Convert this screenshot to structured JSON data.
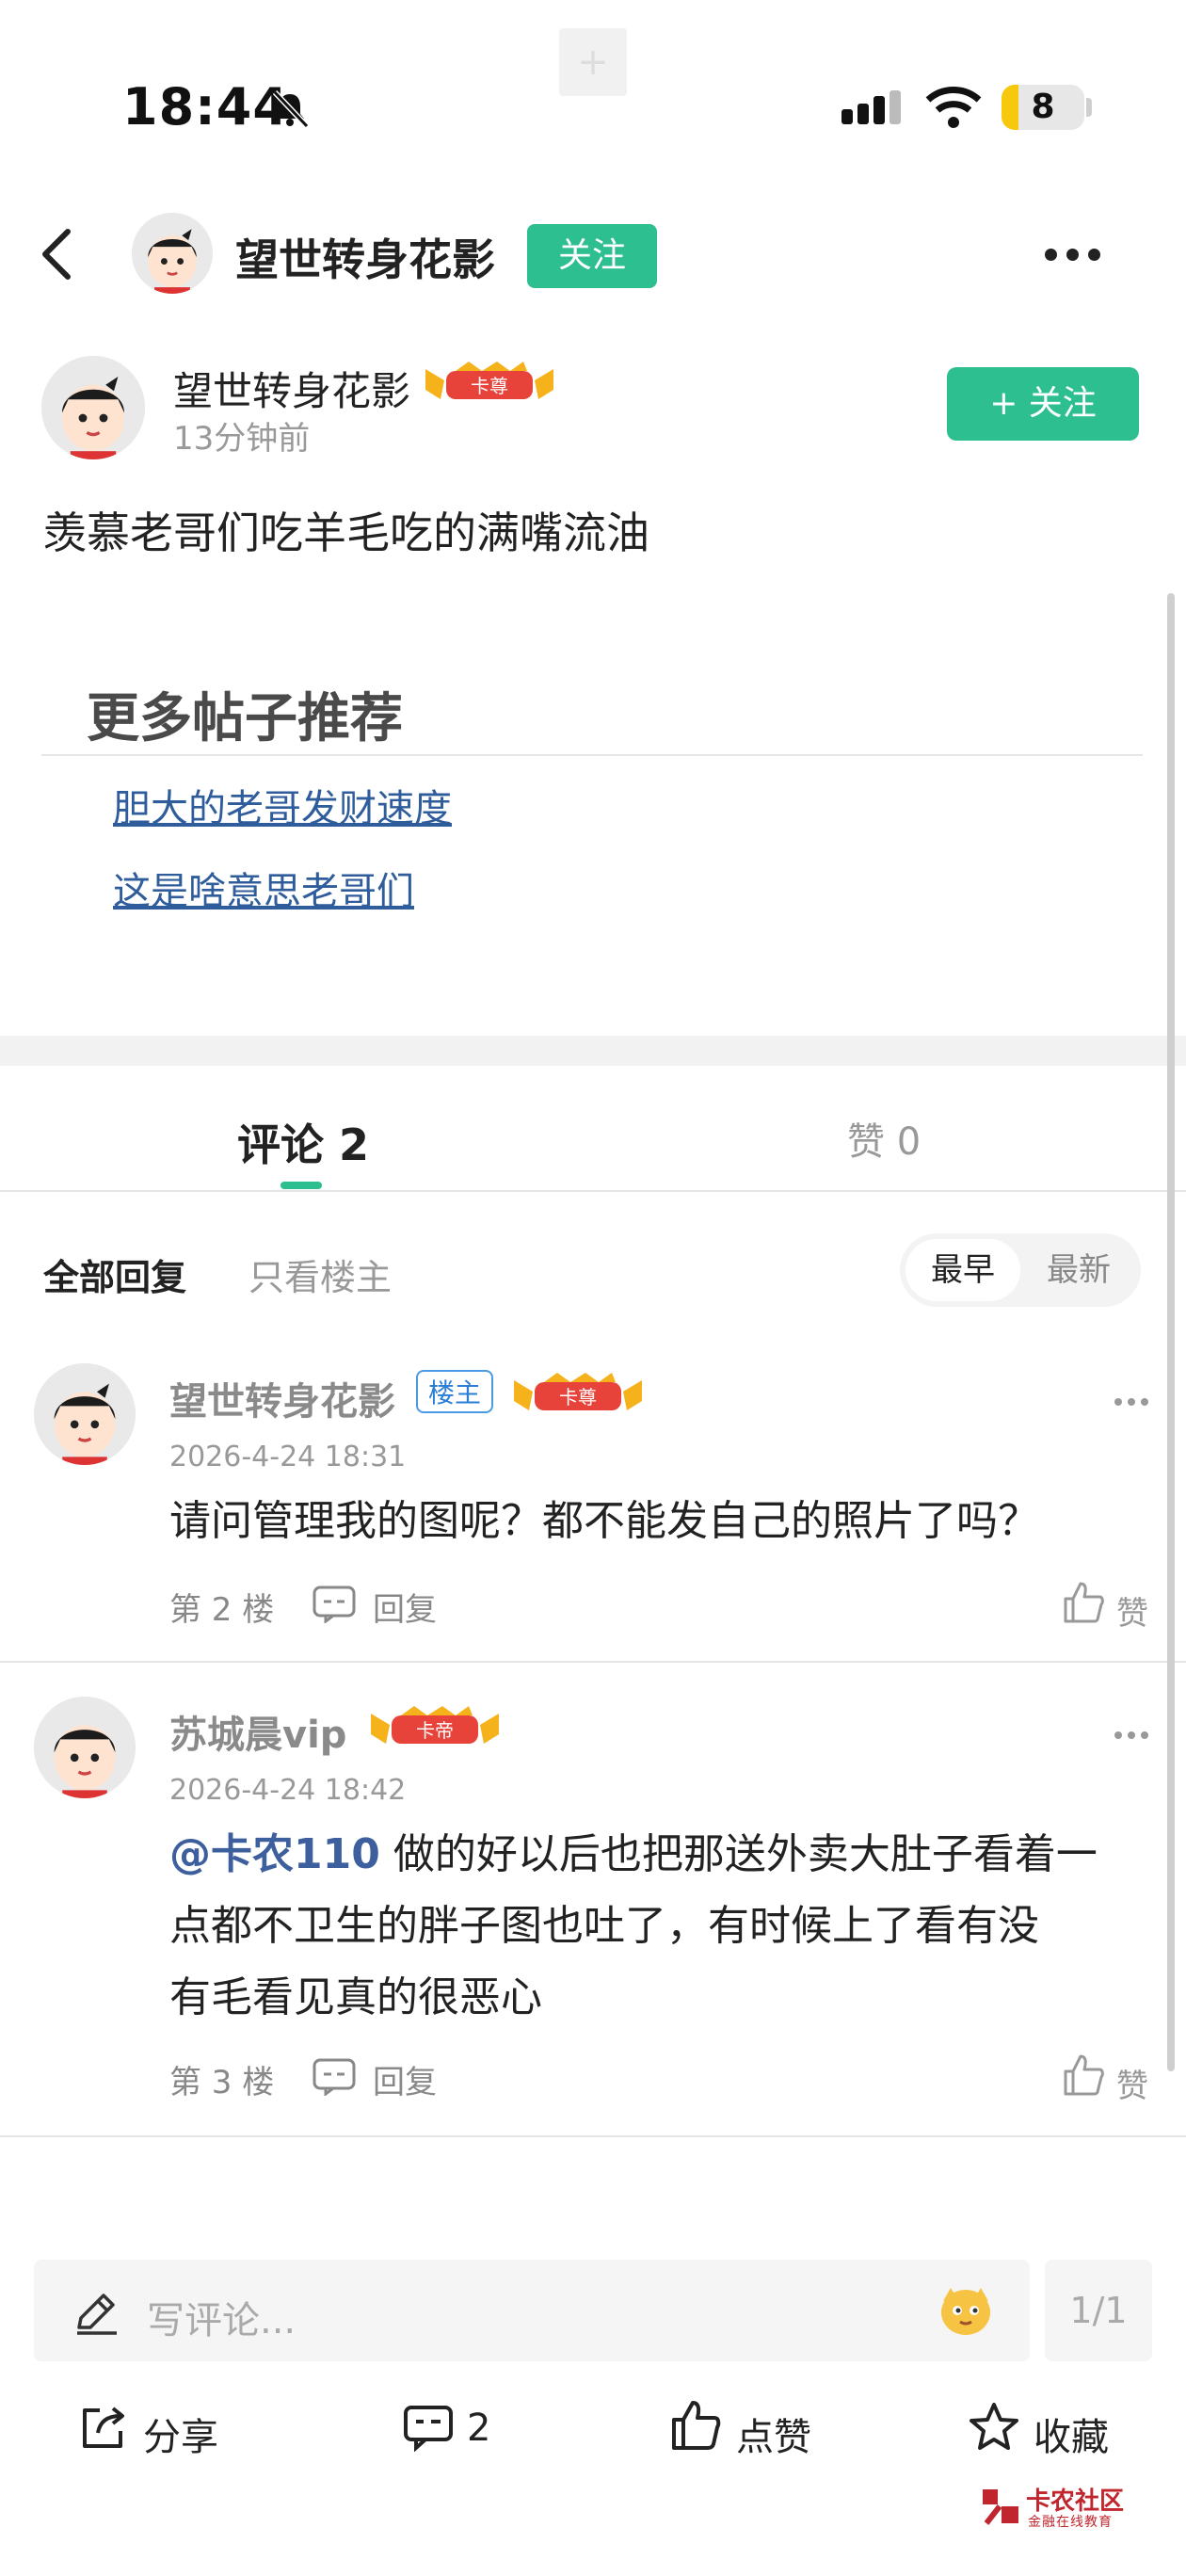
{
  "status_bar": {
    "time": "18:44",
    "battery": "8"
  },
  "header": {
    "name": "望世转身花影",
    "follow_label": "关注"
  },
  "post": {
    "author": "望世转身花影",
    "badge": "卡尊",
    "time": "13分钟前",
    "follow_label": "+ 关注",
    "text": "羡慕老哥们吃羊毛吃的满嘴流油"
  },
  "recommend": {
    "title": "更多帖子推荐",
    "links": [
      "胆大的老哥发财速度",
      "这是啥意思老哥们"
    ]
  },
  "tabs": {
    "comments": "评论 2",
    "likes": "赞 0"
  },
  "filters": {
    "all": "全部回复",
    "owner_only": "只看楼主",
    "sort_early": "最早",
    "sort_new": "最新"
  },
  "comments": [
    {
      "name": "望世转身花影",
      "owner_tag": "楼主",
      "badge": "卡尊",
      "time": "2026-4-24 18:31",
      "text": "请问管理我的图呢？都不能发自己的照片了吗？",
      "floor": "第 2 楼",
      "reply": "回复",
      "like": "赞"
    },
    {
      "name": "苏城晨vip",
      "badge": "卡帝",
      "time": "2026-4-24 18:42",
      "mention": "@卡农110",
      "text_line1": " 做的好以后也把那送外卖大肚子看着一",
      "text_line2": "点都不卫生的胖子图也吐了，有时候上了看有没",
      "text_line3": "有毛看见真的很恶心",
      "floor": "第 3 楼",
      "reply": "回复",
      "like": "赞"
    }
  ],
  "composer": {
    "placeholder": "写评论...",
    "page": "1/1"
  },
  "bottom_bar": {
    "share": "分享",
    "comments": "2",
    "like": "点赞",
    "collect": "收藏"
  },
  "watermark": {
    "main": "卡农社区",
    "sub": "金融在线教育"
  }
}
